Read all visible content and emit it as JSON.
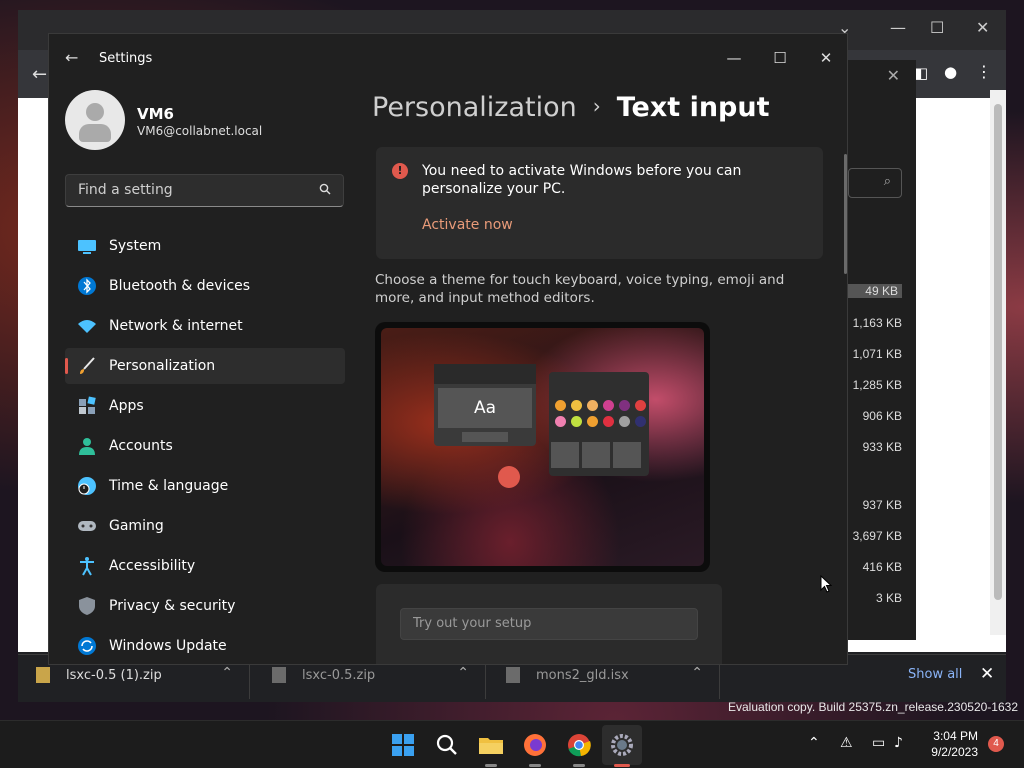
{
  "settings": {
    "window_title": "Settings",
    "profile": {
      "name": "VM6",
      "email": "VM6@collabnet.local"
    },
    "search_placeholder": "Find a setting",
    "nav": [
      {
        "label": "System",
        "icon": "system-icon"
      },
      {
        "label": "Bluetooth & devices",
        "icon": "bluetooth-icon"
      },
      {
        "label": "Network & internet",
        "icon": "wifi-icon"
      },
      {
        "label": "Personalization",
        "icon": "brush-icon",
        "active": true
      },
      {
        "label": "Apps",
        "icon": "apps-icon"
      },
      {
        "label": "Accounts",
        "icon": "accounts-icon"
      },
      {
        "label": "Time & language",
        "icon": "clock-globe-icon"
      },
      {
        "label": "Gaming",
        "icon": "gamepad-icon"
      },
      {
        "label": "Accessibility",
        "icon": "accessibility-icon"
      },
      {
        "label": "Privacy & security",
        "icon": "shield-icon"
      },
      {
        "label": "Windows Update",
        "icon": "update-icon"
      }
    ],
    "breadcrumb": {
      "parent": "Personalization",
      "separator": "›",
      "current": "Text input"
    },
    "activation": {
      "message": "You need to activate Windows before you can personalize your PC.",
      "link": "Activate now"
    },
    "theme_description": "Choose a theme for touch keyboard, voice typing, emoji and more, and input method editors.",
    "preview_key_label": "Aa",
    "tryout_placeholder": "Try out your setup"
  },
  "browser": {
    "file_sizes": [
      "49 KB",
      "1,163 KB",
      "1,071 KB",
      "1,285 KB",
      "906 KB",
      "933 KB",
      "937 KB",
      "3,697 KB",
      "416 KB",
      "3 KB"
    ]
  },
  "downloads": {
    "items": [
      {
        "name": "lsxc-0.5 (1).zip"
      },
      {
        "name": "lsxc-0.5.zip"
      },
      {
        "name": "mons2_gld.isx"
      }
    ],
    "show_all": "Show all"
  },
  "watermark": "Evaluation copy. Build 25375.zn_release.230520-1632",
  "taskbar": {
    "time": "3:04 PM",
    "date": "9/2/2023",
    "notification_count": "4"
  },
  "colors": {
    "accent": "#e0594d",
    "link": "#e99b79",
    "window_bg": "#202020",
    "card_bg": "#2b2b2b"
  }
}
